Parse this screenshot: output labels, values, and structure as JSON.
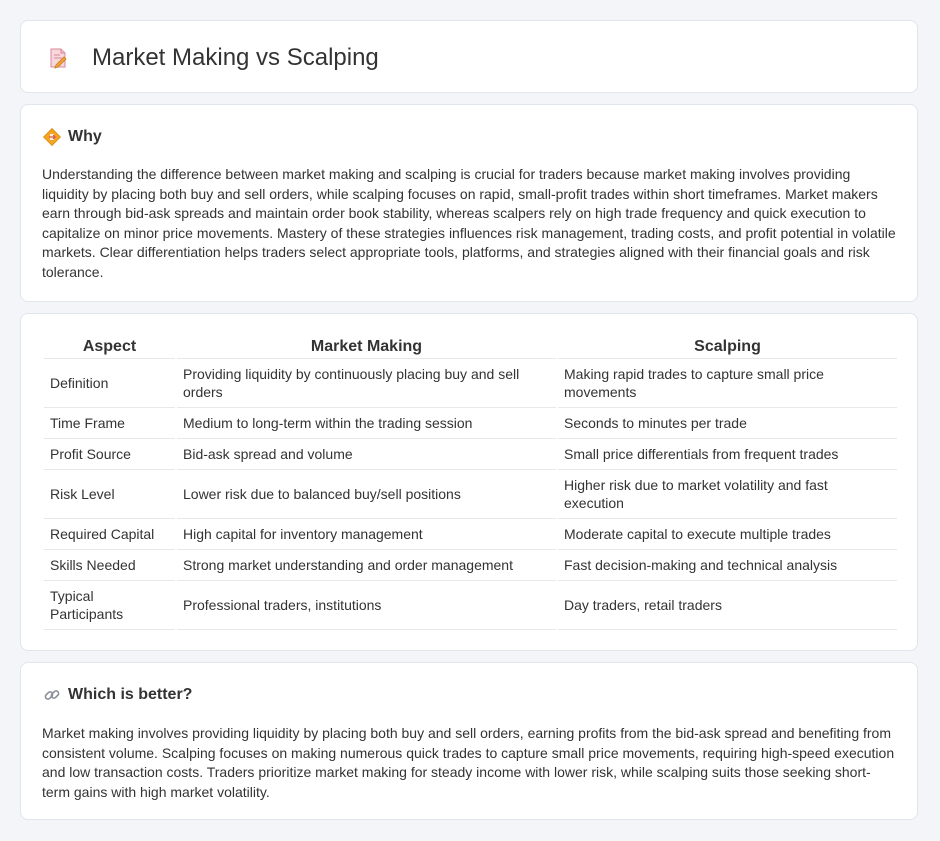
{
  "page": {
    "title": "Market Making vs Scalping",
    "title_icon": "document-pencil-icon"
  },
  "why": {
    "icon": "diamond-sign-icon",
    "heading": "Why",
    "text": "Understanding the difference between market making and scalping is crucial for traders because market making involves providing liquidity by placing both buy and sell orders, while scalping focuses on rapid, small-profit trades within short timeframes. Market makers earn through bid-ask spreads and maintain order book stability, whereas scalpers rely on high trade frequency and quick execution to capitalize on minor price movements. Mastery of these strategies influences risk management, trading costs, and profit potential in volatile markets. Clear differentiation helps traders select appropriate tools, platforms, and strategies aligned with their financial goals and risk tolerance."
  },
  "table": {
    "headers": [
      "Aspect",
      "Market Making",
      "Scalping"
    ],
    "rows": [
      [
        "Definition",
        "Providing liquidity by continuously placing buy and sell orders",
        "Making rapid trades to capture small price movements"
      ],
      [
        "Time Frame",
        "Medium to long-term within the trading session",
        "Seconds to minutes per trade"
      ],
      [
        "Profit Source",
        "Bid-ask spread and volume",
        "Small price differentials from frequent trades"
      ],
      [
        "Risk Level",
        "Lower risk due to balanced buy/sell positions",
        "Higher risk due to market volatility and fast execution"
      ],
      [
        "Required Capital",
        "High capital for inventory management",
        "Moderate capital to execute multiple trades"
      ],
      [
        "Skills Needed",
        "Strong market understanding and order management",
        "Fast decision-making and technical analysis"
      ],
      [
        "Typical Participants",
        "Professional traders, institutions",
        "Day traders, retail traders"
      ]
    ]
  },
  "better": {
    "icon": "link-icon",
    "heading": "Which is better?",
    "text": "Market making involves providing liquidity by placing both buy and sell orders, earning profits from the bid-ask spread and benefiting from consistent volume. Scalping focuses on making numerous quick trades to capture small price movements, requiring high-speed execution and low transaction costs. Traders prioritize market making for steady income with lower risk, while scalping suits those seeking short-term gains with high market volatility."
  },
  "colors": {
    "background": "#f3f5f9",
    "card": "#ffffff",
    "border": "#e1e5ec",
    "text": "#333333",
    "accent_orange": "#f0a020",
    "icon_pink": "#e07a8a"
  }
}
